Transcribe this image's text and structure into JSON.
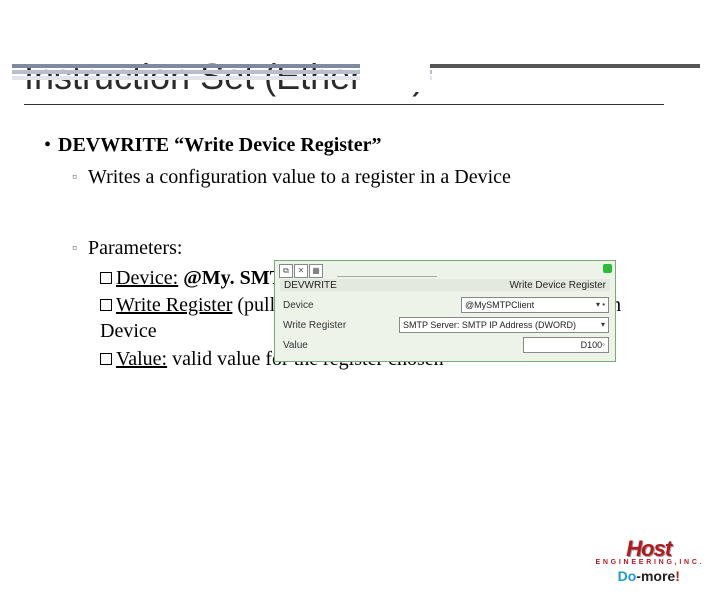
{
  "title": "Instruction Set (Ethernet)",
  "bullet": {
    "name": "DEVWRITE",
    "quoted": "“Write Device Register”"
  },
  "sub1": "Writes a configuration value to a register in a Device",
  "sub2": "Parameters:",
  "params": {
    "p1_label": "Device:",
    "p1_value": "@My. SMTPClient",
    "p2_label": "Write Register",
    "p2_rest": " (pull-down selection): valid registers for chosen Device",
    "p3_label": "Value:",
    "p3_rest": " valid value for the register chosen"
  },
  "panel": {
    "cmd": "DEVWRITE",
    "cmd_title": "Write Device Register",
    "row1_label": "Device",
    "row1_value": "@MySMTPClient",
    "row2_label": "Write Register",
    "row2_value": "SMTP Server: SMTP IP Address (DWORD)",
    "row3_label": "Value",
    "row3_value": "D100"
  },
  "logo": {
    "host": "Host",
    "tag": "E N G I N E E R I N G , I N C .",
    "do": "Do",
    "more": "-more",
    "ex": "!"
  }
}
